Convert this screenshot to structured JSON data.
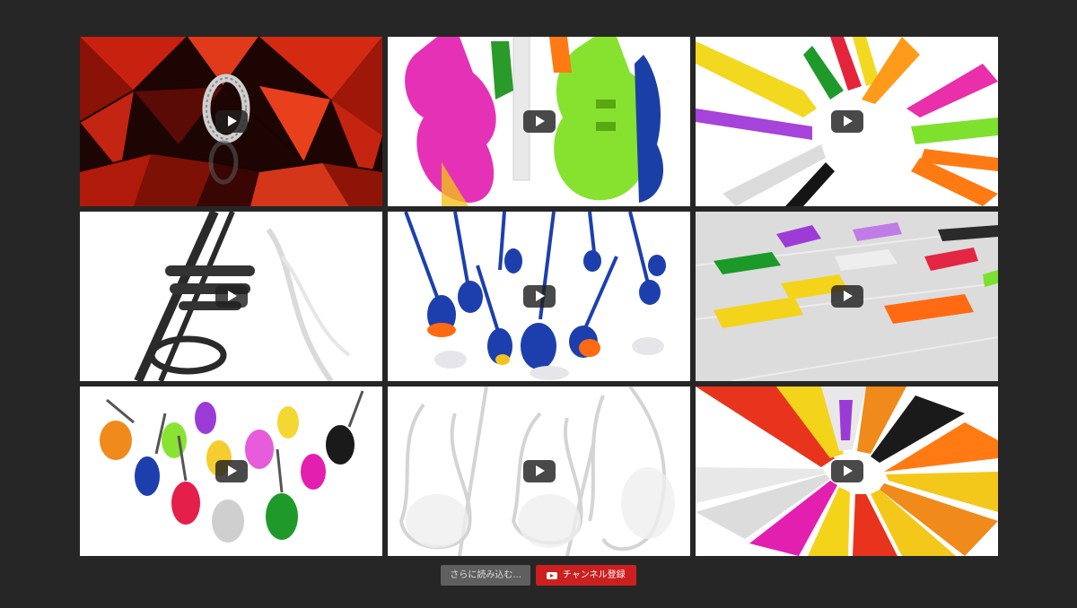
{
  "videos": [
    {
      "name": "video-thumb-ring-red",
      "subject": "ring in red crystal room"
    },
    {
      "name": "video-thumb-guitars",
      "subject": "colorful translucent electric guitars"
    },
    {
      "name": "video-thumb-saxophones",
      "subject": "colorful saxophones in a circle"
    },
    {
      "name": "video-thumb-trumpet",
      "subject": "black trumpet"
    },
    {
      "name": "video-thumb-bass-guitars",
      "subject": "blue bass guitars"
    },
    {
      "name": "video-thumb-keyboards",
      "subject": "colorful keyboards"
    },
    {
      "name": "video-thumb-violins",
      "subject": "colorful violins"
    },
    {
      "name": "video-thumb-clear-violins",
      "subject": "clear violins"
    },
    {
      "name": "video-thumb-harps",
      "subject": "colorful harps in a circle"
    }
  ],
  "actions": {
    "load_more_label": "さらに読み込む...",
    "subscribe_label": "チャンネル登録"
  },
  "colors": {
    "background": "#262626",
    "subscribe": "#cc1f1f",
    "load_more": "#5f5f5f"
  }
}
